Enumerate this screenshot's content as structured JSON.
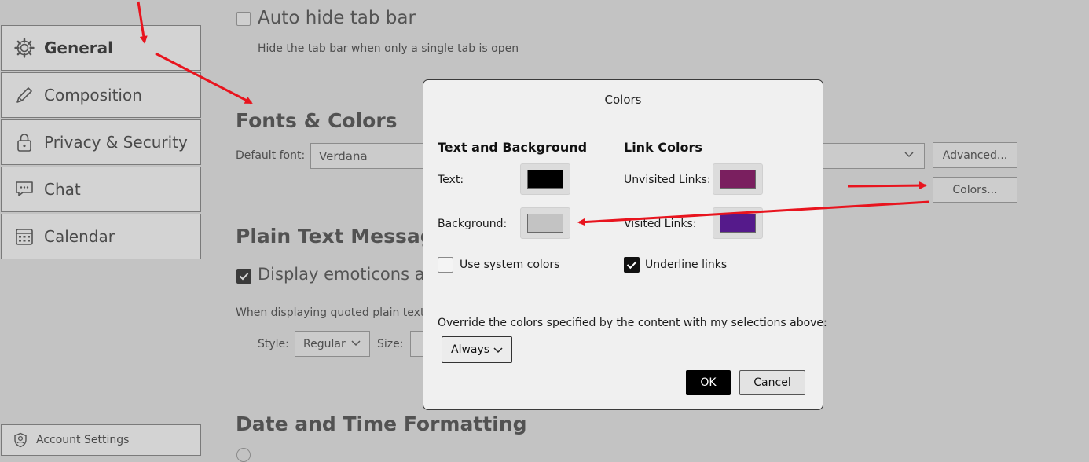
{
  "sidebar": {
    "items": [
      {
        "label": "General",
        "icon": "gear-icon"
      },
      {
        "label": "Composition",
        "icon": "pencil-icon"
      },
      {
        "label": "Privacy & Security",
        "icon": "lock-icon"
      },
      {
        "label": "Chat",
        "icon": "chat-icon"
      },
      {
        "label": "Calendar",
        "icon": "calendar-icon"
      }
    ],
    "account_settings": "Account Settings"
  },
  "main": {
    "auto_hide": {
      "label": "Auto hide tab bar",
      "description": "Hide the tab bar when only a single tab is open"
    },
    "fonts_colors": {
      "heading": "Fonts & Colors",
      "default_font_label": "Default font:",
      "default_font_value": "Verdana",
      "advanced_button": "Advanced...",
      "colors_button": "Colors..."
    },
    "plain_text": {
      "heading": "Plain Text Message",
      "display_emoticons": "Display emoticons as",
      "quoted_text": "When displaying quoted plain text m",
      "style_label": "Style:",
      "style_value": "Regular",
      "size_label": "Size:"
    },
    "date_time": {
      "heading": "Date and Time Formatting"
    }
  },
  "dialog": {
    "title": "Colors",
    "text_bg_heading": "Text and Background",
    "link_colors_heading": "Link Colors",
    "text_label": "Text:",
    "background_label": "Background:",
    "unvisited_label": "Unvisited Links:",
    "visited_label": "Visited Links:",
    "use_system_colors": "Use system colors",
    "underline_links": "Underline links",
    "override_label": "Override the colors specified by the content with my selections above:",
    "override_value": "Always",
    "ok": "OK",
    "cancel": "Cancel",
    "colors": {
      "text": "#000000",
      "background": "#c3c3c3",
      "unvisited": "#7a1f5f",
      "visited": "#551a8b"
    }
  },
  "annotation_color": "#e8141e"
}
